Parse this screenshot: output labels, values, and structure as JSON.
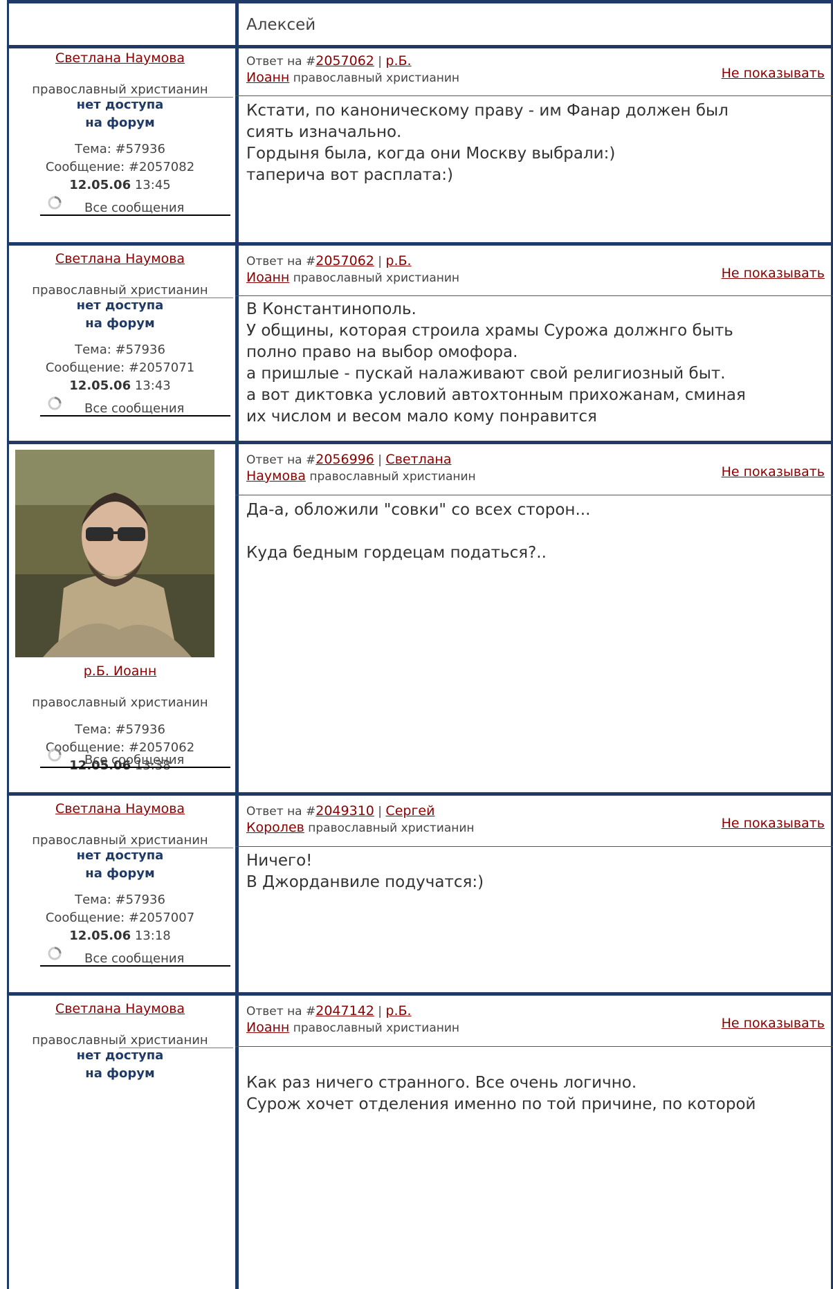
{
  "top": {
    "username": "Алексей"
  },
  "labels": {
    "reply_prefix": "Ответ на #",
    "hide": "Не показывать",
    "topic_prefix": "Тема: #",
    "message_prefix": "Сообщение: #",
    "all_messages": "Все сообщения",
    "no_access_line1": "нет доступа",
    "no_access_line2": "на форум"
  },
  "posts": [
    {
      "author": "Светлана Наумова",
      "author_role": "православный христианин",
      "no_access": true,
      "topic": "57936",
      "message": "2057082",
      "date": "12.05.06",
      "time": "13:45",
      "reply_to_id": "2057062",
      "reply_to_user_a": "р.Б.",
      "reply_to_user_b": "Иоанн",
      "reply_to_role": "православный христианин",
      "body": "Кстати, по каноническому праву - им Фанар должен был\nсиять изначально.\nГордыня была, когда они Москву выбрали:)\nтаперича вот расплата:)"
    },
    {
      "author": "Светлана Наумова",
      "author_role": "православный христианин",
      "no_access": true,
      "topic": "57936",
      "message": "2057071",
      "date": "12.05.06",
      "time": "13:43",
      "reply_to_id": "2057062",
      "reply_to_user_a": "р.Б.",
      "reply_to_user_b": "Иоанн",
      "reply_to_role": "православный христианин",
      "body": "В Константинополь.\nУ общины, которая строила храмы Сурожа должнго быть\nполно право на выбор омофора.\nа пришлые - пускай налаживают свой религиозный быт.\nа вот диктовка условий автохтонным прихожанам, сминая\nих числом и весом мало кому понравится"
    },
    {
      "author": "р.Б. Иоанн",
      "author_role": "православный христианин",
      "no_access": false,
      "has_avatar": true,
      "topic": "57936",
      "message": "2057062",
      "date": "12.05.06",
      "time": "13:38",
      "reply_to_id": "2056996",
      "reply_to_user_a": "Светлана",
      "reply_to_user_b": "Наумова",
      "reply_to_role": "православный христианин",
      "body": "Да-а, обложили \"совки\" со всех сторон...\n\nКуда бедным гордецам податься?.."
    },
    {
      "author": "Светлана Наумова",
      "author_role": "православный христианин",
      "no_access": true,
      "topic": "57936",
      "message": "2057007",
      "date": "12.05.06",
      "time": "13:18",
      "reply_to_id": "2049310",
      "reply_to_user_a": "Сергей",
      "reply_to_user_b": "Королев",
      "reply_to_role": "православный христианин",
      "body": "Ничего!\nВ Джорданвиле подучатся:)"
    },
    {
      "author": "Светлана Наумова",
      "author_role": "православный христианин",
      "no_access": true,
      "reply_to_id": "2047142",
      "reply_to_user_a": "р.Б.",
      "reply_to_user_b": "Иоанн",
      "reply_to_role": "православный христианин",
      "body": "Как раз ничего странного. Все очень логично.\nСурож хочет отделения именно по той причине, по которой"
    }
  ],
  "colors": {
    "frame": "#1f3a66",
    "link": "#8b0000",
    "no_access": "#1f3a66"
  }
}
